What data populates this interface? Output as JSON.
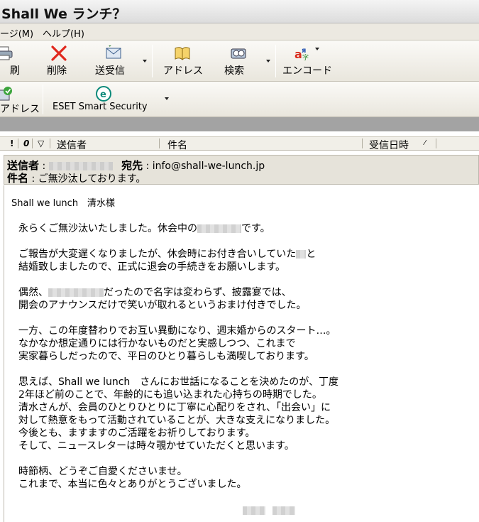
{
  "window": {
    "title": "Shall We ランチ？"
  },
  "menu": {
    "items": [
      "ージ(M)",
      "ヘルプ(H)"
    ]
  },
  "toolbar1": {
    "buttons": [
      "印刷",
      "削除",
      "送受信",
      "アドレス",
      "検索",
      "エンコード"
    ]
  },
  "toolbar2": {
    "buttons": [
      "アドレス",
      "ESET Smart Security"
    ]
  },
  "columns": {
    "icons": [
      "!",
      "0",
      "▽"
    ],
    "from": "送信者",
    "subject": "件名",
    "received": "受信日時"
  },
  "message": {
    "from_label": "送信者",
    "to_label": "宛先",
    "to_value": "info@shall-we-lunch.jp",
    "subject_label": "件名",
    "subject_value": "ご無沙汰しております。",
    "greeting": "Shall we lunch　清水様",
    "paragraphs": [
      [
        "永らくご無沙汰いたしました。休会中の",
        "です。"
      ],
      [
        "ご報告が大変遅くなりましたが、休会時にお付き合いしていた",
        "と",
        "結婚致しましたので、正式に退会の手続きをお願いします。"
      ],
      [
        "偶然、",
        "だったので名字は変わらず、披露宴では、",
        "開会のアナウンスだけで笑いが取れるというおまけ付きでした。"
      ],
      [
        "一方、この年度替わりでお互い異動になり、週末婚からのスタート…。",
        "なかなか想定通りには行かないものだと実感しつつ、これまで",
        "実家暮らしだったので、平日のひとり暮らしも満喫しております。"
      ],
      [
        "思えば、Shall we lunch　さんにお世話になることを決めたのが、丁度",
        "2年ほど前のことで、年齢的にも追い込まれた心持ちの時期でした。",
        "清水さんが、会員のひとりひとりに丁寧に心配りをされ、「出会い」に",
        "対して熱意をもって活動されていることが、大きな支えになりました。",
        "今後とも、ますますのご活躍をお祈りしております。",
        "そして、ニュースレターは時々覗かせていただくと思います。"
      ],
      [
        "時節柄、どうぞご自愛くださいませ。",
        "これまで、本当に色々とありがとうございました。"
      ]
    ]
  }
}
